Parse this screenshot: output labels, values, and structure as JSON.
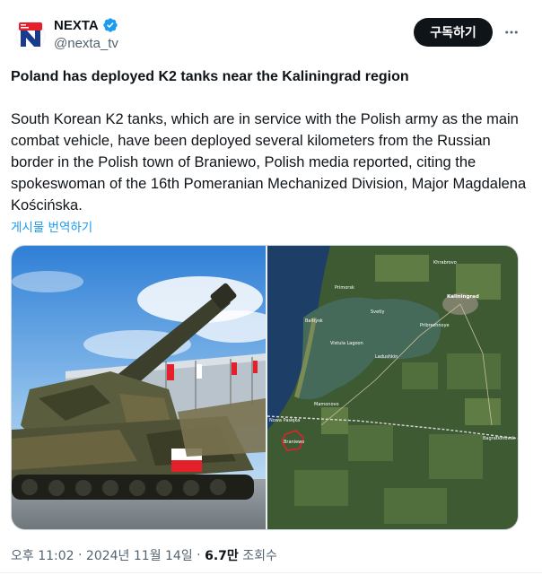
{
  "account": {
    "display_name": "NEXTA",
    "handle": "@nexta_tv",
    "verified": true,
    "avatar_icon": "nexta-logo-icon",
    "subscribe_label": "구독하기",
    "more_icon": "more-dots-icon"
  },
  "tweet": {
    "title": "Poland has deployed K2 tanks near the Kaliningrad region",
    "body": "South Korean K2 tanks, which are in service with the Polish army as the main combat vehicle, have been deployed several kilometers from the Russian border in the Polish town of Braniewo, Polish media reported, citing the spokeswoman of the 16th Pomeranian Mechanized Division, Major Magdalena Kościńska.",
    "translate_label": "게시물 번역하기"
  },
  "media": {
    "left_image": "k2-tank-photo",
    "right_image": "kaliningrad-satellite-map",
    "map_labels": {
      "khrabrovo": "Khrabrovo\nХраброво",
      "primorsk": "Primorsk\nПриморск",
      "kaliningrad": "Kaliningrad\nКалининград",
      "baltiysk": "Baltiysk\nБалтийск",
      "svetly": "Svetly\nСветлый",
      "pribrezhnoye": "Pribrezhnoye\nПрибрежное",
      "vistula_lagoon": "Vistula Lagoon\nКалининградский залив",
      "ladushkin": "Ladushkin\nЛадушкин",
      "mamonovo": "Mamonovo\nМамоново",
      "nova_pasleka": "Nowa Pasłęka",
      "braniewo": "Braniewo",
      "bagrationovsk": "Bagrationovsk\nБагратионовск"
    }
  },
  "meta": {
    "time": "오후 11:02",
    "date": "2024년 11월 14일",
    "views_count": "6.7만",
    "views_label": "조회수"
  },
  "colors": {
    "text": "#0f1419",
    "secondary": "#536471",
    "link": "#1d9bf0",
    "verified": "#1d9bf0",
    "button_bg": "#0f1419"
  }
}
